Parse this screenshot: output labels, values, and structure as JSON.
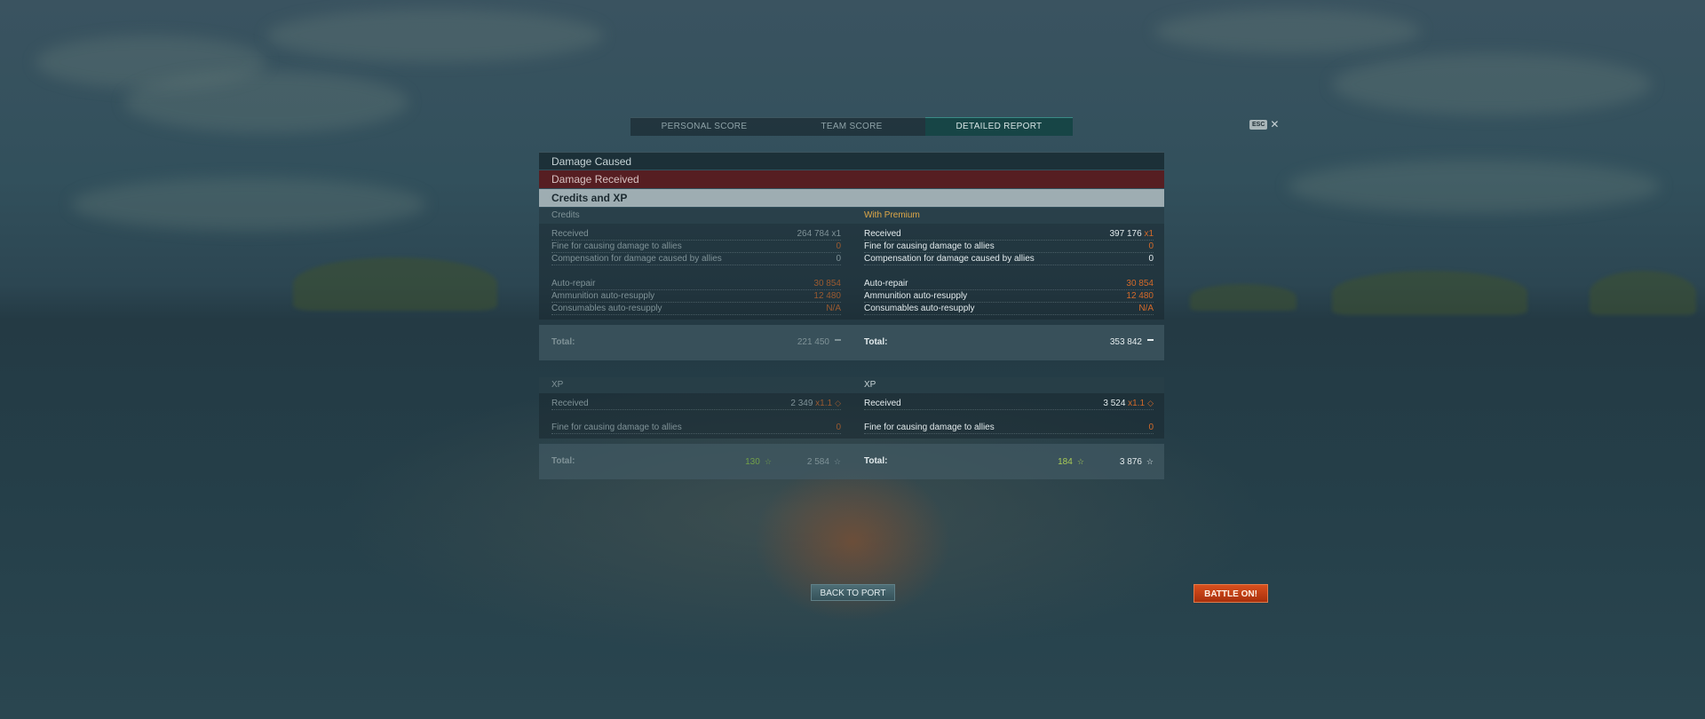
{
  "tabs": {
    "personal_score": "PERSONAL SCORE",
    "team_score": "TEAM SCORE",
    "detailed_report": "DETAILED REPORT"
  },
  "esc": {
    "key": "ESC",
    "close": "✕"
  },
  "sections": {
    "damage_caused": "Damage Caused",
    "damage_received": "Damage Received",
    "credits_xp": "Credits and XP"
  },
  "credits": {
    "left": {
      "header": "Credits",
      "received_label": "Received",
      "received_value": "264 784",
      "received_mult": "x1",
      "fine_label": "Fine for causing damage to allies",
      "fine_value": "0",
      "comp_label": "Compensation for damage caused by allies",
      "comp_value": "0",
      "repair_label": "Auto-repair",
      "repair_value": "30 854",
      "ammo_label": "Ammunition auto-resupply",
      "ammo_value": "12 480",
      "cons_label": "Consumables auto-resupply",
      "cons_value": "N/A",
      "total_label": "Total:",
      "total_value": "221 450"
    },
    "right": {
      "header": "With Premium",
      "received_label": "Received",
      "received_value": "397 176",
      "received_mult": "x1",
      "fine_label": "Fine for causing damage to allies",
      "fine_value": "0",
      "comp_label": "Compensation for damage caused by allies",
      "comp_value": "0",
      "repair_label": "Auto-repair",
      "repair_value": "30 854",
      "ammo_label": "Ammunition auto-resupply",
      "ammo_value": "12 480",
      "cons_label": "Consumables auto-resupply",
      "cons_value": "N/A",
      "total_label": "Total:",
      "total_value": "353 842"
    }
  },
  "xp": {
    "left": {
      "header": "XP",
      "received_label": "Received",
      "received_value": "2 349",
      "received_mult": "x1.1",
      "fine_label": "Fine for causing damage to allies",
      "fine_value": "0",
      "total_label": "Total:",
      "total_free": "130",
      "total_value": "2 584"
    },
    "right": {
      "header": "XP",
      "received_label": "Received",
      "received_value": "3 524",
      "received_mult": "x1.1",
      "fine_label": "Fine for causing damage to allies",
      "fine_value": "0",
      "total_label": "Total:",
      "total_free": "184",
      "total_value": "3 876"
    }
  },
  "buttons": {
    "back_to_port": "BACK TO PORT",
    "battle_on": "BATTLE ON!"
  },
  "icons": {
    "star": "☆",
    "rank": "◇"
  }
}
